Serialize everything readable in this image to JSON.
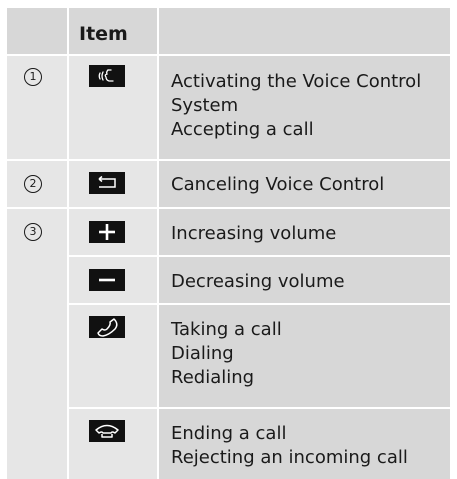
{
  "table": {
    "header": {
      "col1": "",
      "col2": "Item",
      "col3": ""
    },
    "groups": [
      {
        "number": "1",
        "rows": [
          {
            "icon": "voice-control-key-icon",
            "lines": [
              "Activating the Voice Control",
              "System",
              "Accepting a call"
            ]
          }
        ]
      },
      {
        "number": "2",
        "rows": [
          {
            "icon": "back-key-icon",
            "lines": [
              "Canceling Voice Control"
            ]
          }
        ]
      },
      {
        "number": "3",
        "rows": [
          {
            "icon": "plus-key-icon",
            "lines": [
              "Increasing volume"
            ]
          },
          {
            "icon": "minus-key-icon",
            "lines": [
              "Decreasing volume"
            ]
          },
          {
            "icon": "phone-pickup-key-icon",
            "lines": [
              "Taking a call",
              "Dialing",
              "Redialing"
            ]
          },
          {
            "icon": "phone-hangup-key-icon",
            "lines": [
              "Ending a call",
              "Rejecting an incoming call"
            ]
          }
        ]
      }
    ]
  },
  "colors": {
    "header_cell": "#d7d7d7",
    "number_col": "#e6e6e6",
    "body_cell": "#d7d7d7",
    "key_bg": "#111111",
    "divider": "#ffffff"
  }
}
